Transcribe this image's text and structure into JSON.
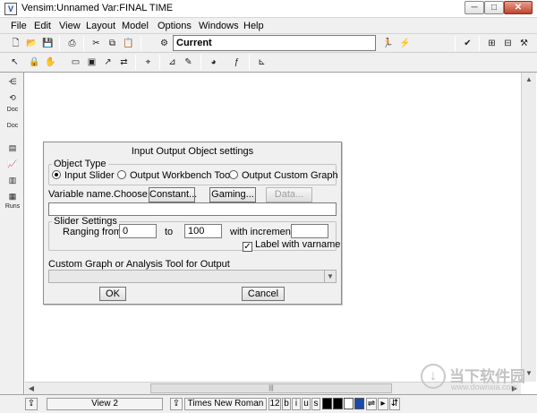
{
  "window": {
    "title": "Vensim:Unnamed Var:FINAL TIME",
    "app_icon_text": "V",
    "minimize": "─",
    "maximize": "□",
    "close": "✕"
  },
  "menu": [
    "File",
    "Edit",
    "View",
    "Layout",
    "Model",
    "Options",
    "Windows",
    "Help"
  ],
  "toolbar": {
    "current_value": "Current"
  },
  "left_tools": {
    "doc1": "Doc",
    "doc2": "Doc",
    "runs": "Runs"
  },
  "dialog": {
    "title": "Input Output Object settings",
    "object_type": {
      "legend": "Object Type",
      "options": [
        "Input Slider",
        "Output Workbench Tool",
        "Output Custom Graph"
      ],
      "selected": "Input Slider"
    },
    "variable_label": "Variable name.",
    "choose_label": "Choose:",
    "constant_button": "Constant...",
    "gaming_button": "Gaming...",
    "data_button": "Data...",
    "variable_value": "",
    "slider": {
      "legend": "Slider Settings",
      "ranging_label": "Ranging from",
      "from_value": "0",
      "to_label": "to",
      "to_value": "100",
      "increment_label": "with increment",
      "increment_value": "",
      "label_checkbox": "Label with varname",
      "label_checked": true
    },
    "custom_graph_label": "Custom Graph or Analysis Tool for Output",
    "ok_button": "OK",
    "cancel_button": "Cancel"
  },
  "statusbar": {
    "view": "View 2",
    "font": "Times New Roman",
    "font_size": "12",
    "bold": "b",
    "italic": "i",
    "underline": "u",
    "strike": "s"
  },
  "watermark": {
    "brand": "当下软件园",
    "url": "www.downxia.com"
  },
  "colors": {
    "chrome_bg": "#f0f0f0",
    "accent_blue": "#1b4aa8"
  }
}
